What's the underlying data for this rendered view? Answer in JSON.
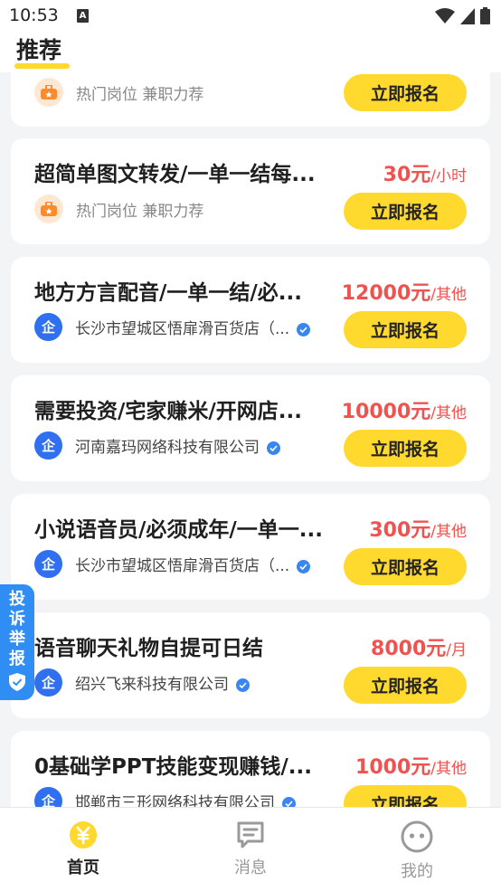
{
  "status_bar": {
    "time": "10:53",
    "notif_icon": "A"
  },
  "header": {
    "title": "推荐"
  },
  "cards": [
    {
      "title": "",
      "price": "",
      "unit": "",
      "badge": "hot",
      "sub": "热门岗位 兼职力荐",
      "verified": false,
      "button": "立即报名"
    },
    {
      "title": "超简单图文转发/一单一结每...",
      "price": "30元",
      "unit": "/小时",
      "badge": "hot",
      "sub": "热门岗位 兼职力荐",
      "verified": false,
      "button": "立即报名"
    },
    {
      "title": "地方方言配音/一单一结/必...",
      "price": "12000元",
      "unit": "/其他",
      "badge": "company",
      "badge_text": "企",
      "sub": "长沙市望城区悟扉滑百货店（...",
      "verified": true,
      "button": "立即报名"
    },
    {
      "title": "需要投资/宅家赚米/开网店...",
      "price": "10000元",
      "unit": "/其他",
      "badge": "company",
      "badge_text": "企",
      "sub": "河南嘉玛网络科技有限公司",
      "verified": true,
      "button": "立即报名"
    },
    {
      "title": "小说语音员/必须成年/一单一...",
      "price": "300元",
      "unit": "/其他",
      "badge": "company",
      "badge_text": "企",
      "sub": "长沙市望城区悟扉滑百货店（...",
      "verified": true,
      "button": "立即报名"
    },
    {
      "title": "语音聊天礼物自提可日结",
      "price": "8000元",
      "unit": "/月",
      "badge": "company",
      "badge_text": "企",
      "sub": "绍兴飞来科技有限公司",
      "verified": true,
      "button": "立即报名"
    },
    {
      "title": "0基础学PPT技能变现赚钱/...",
      "price": "1000元",
      "unit": "/其他",
      "badge": "company",
      "badge_text": "企",
      "sub": "邯郸市三形网络科技有限公司",
      "verified": true,
      "button": "立即报名"
    }
  ],
  "report": {
    "label": "投诉举报"
  },
  "tabbar": {
    "items": [
      {
        "label": "首页",
        "icon": "yuan-coin-icon",
        "active": true
      },
      {
        "label": "消息",
        "icon": "message-icon",
        "active": false
      },
      {
        "label": "我的",
        "icon": "profile-face-icon",
        "active": false
      }
    ]
  },
  "colors": {
    "accent": "#ffd92e",
    "price": "#ef5350",
    "company_badge": "#2f6ff0",
    "report": "#2f8df3"
  }
}
